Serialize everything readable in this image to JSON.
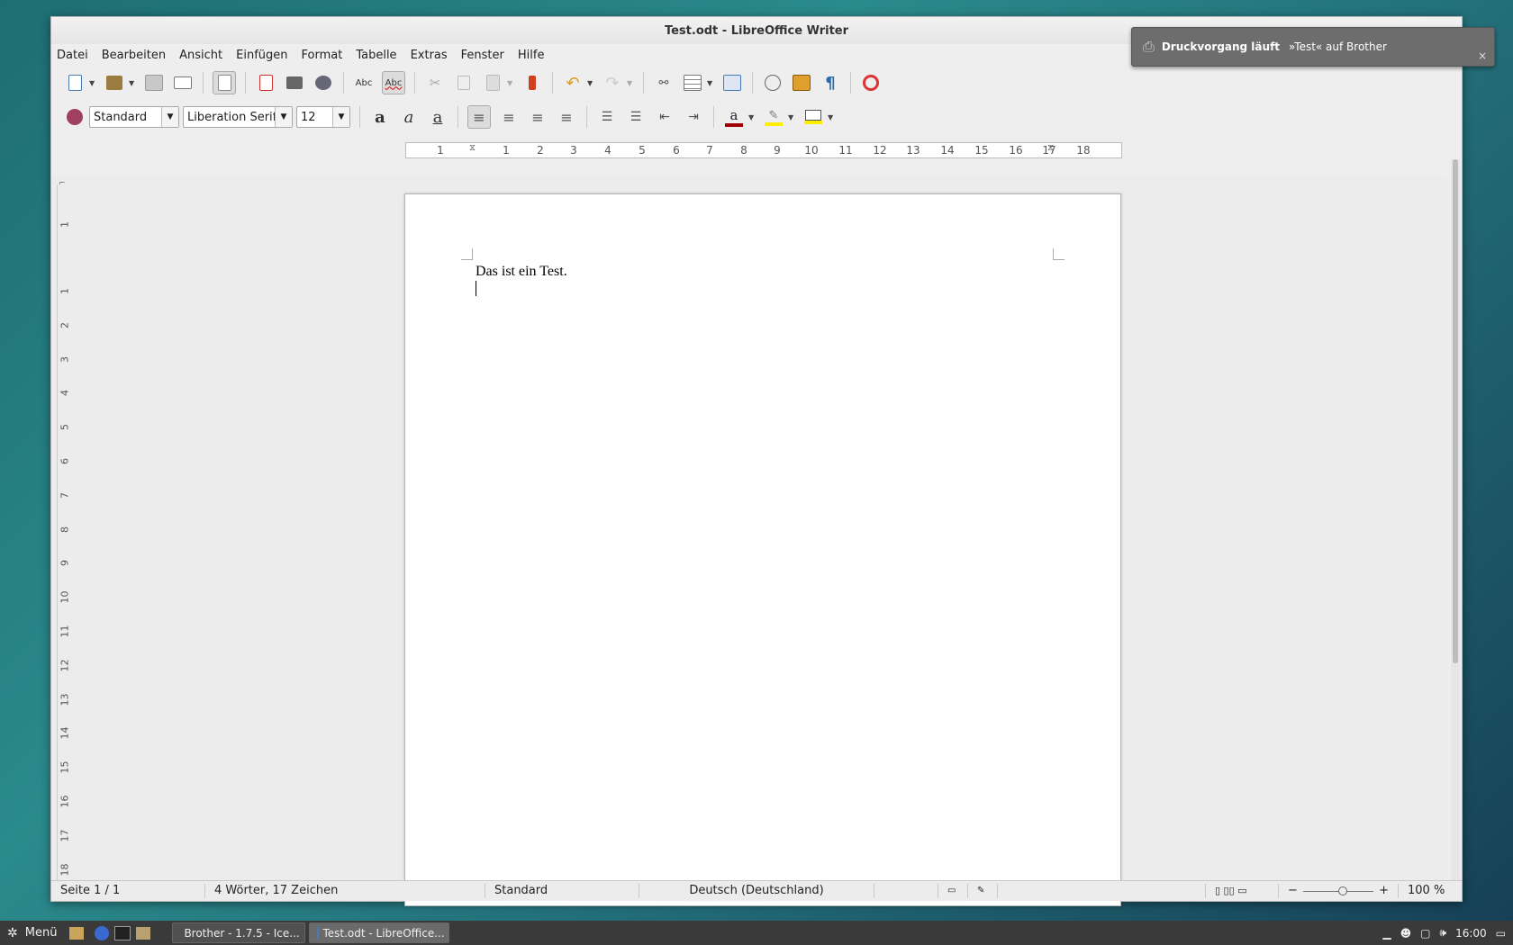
{
  "window": {
    "title": "Test.odt - LibreOffice Writer"
  },
  "menu": [
    "Datei",
    "Bearbeiten",
    "Ansicht",
    "Einfügen",
    "Format",
    "Tabelle",
    "Extras",
    "Fenster",
    "Hilfe"
  ],
  "formatting": {
    "paragraph_style": "Standard",
    "font_name": "Liberation Serif",
    "font_size": "12"
  },
  "ruler": {
    "ticks": [
      "1",
      "1",
      "2",
      "3",
      "4",
      "5",
      "6",
      "7",
      "8",
      "9",
      "10",
      "11",
      "12",
      "13",
      "14",
      "15",
      "16",
      "17",
      "18"
    ]
  },
  "vruler": {
    "ticks": [
      "1",
      "1",
      "2",
      "3",
      "4",
      "5",
      "6",
      "7",
      "8",
      "9",
      "10",
      "11",
      "12",
      "13",
      "14",
      "15",
      "16",
      "17",
      "18"
    ]
  },
  "document": {
    "text": "Das ist ein Test."
  },
  "status": {
    "page": "Seite 1 / 1",
    "words": "4 Wörter, 17 Zeichen",
    "style": "Standard",
    "language": "Deutsch (Deutschland)",
    "zoom_minus": "−",
    "zoom_plus": "+",
    "zoom": "100 %"
  },
  "notification": {
    "title": "Druckvorgang läuft",
    "message": "»Test« auf Brother",
    "close": "×"
  },
  "taskbar": {
    "menu_label": "Menü",
    "tasks": [
      "Brother - 1.7.5 - Ice...",
      "Test.odt - LibreOffice..."
    ],
    "clock": "16:00"
  },
  "icons": {
    "new": "new-doc-icon",
    "open": "open-icon",
    "save": "save-icon",
    "email": "email-icon",
    "edit": "edit-mode-icon",
    "pdf": "pdf-icon",
    "print": "print-icon",
    "preview": "preview-icon",
    "spell": "spellcheck-icon",
    "autospell": "autospell-icon",
    "cut": "cut-icon",
    "copy": "copy-icon",
    "paste": "paste-icon",
    "clone": "clone-format-icon",
    "undo": "undo-icon",
    "redo": "redo-icon",
    "hyperlink": "hyperlink-icon",
    "table": "table-icon",
    "draw": "show-draw-icon",
    "navigator": "navigator-icon",
    "gallery": "gallery-icon",
    "formatting_marks": "pilcrow-icon",
    "help": "help-lifebuoy-icon"
  }
}
